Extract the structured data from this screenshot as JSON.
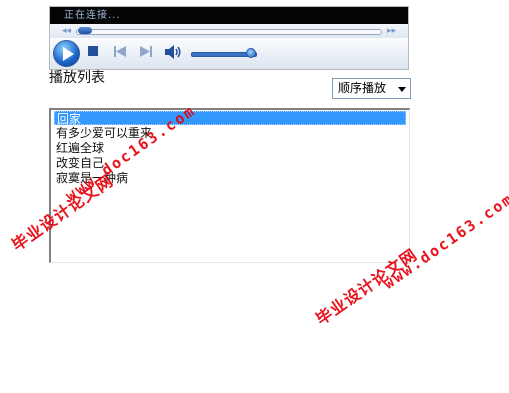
{
  "player": {
    "status_text": "正在连接...",
    "seek_back_icon": "rewind-icon",
    "seek_forward_icon": "fast-forward-icon",
    "volume_level": 0.93,
    "accent_color": "#1a64c8",
    "status_text_color": "#9fb7d8"
  },
  "playlist": {
    "label": "播放列表",
    "order_mode": "顺序播放",
    "items": [
      {
        "title": "回家",
        "selected": true
      },
      {
        "title": "有多少爱可以重来",
        "selected": false
      },
      {
        "title": "红遍全球",
        "selected": false
      },
      {
        "title": "改变自己",
        "selected": false
      },
      {
        "title": "寂寞是一种病",
        "selected": false
      }
    ]
  },
  "watermarks": {
    "url": "www.doc163.com",
    "site_name": "毕业设计论文网",
    "color": "#e8000a"
  }
}
